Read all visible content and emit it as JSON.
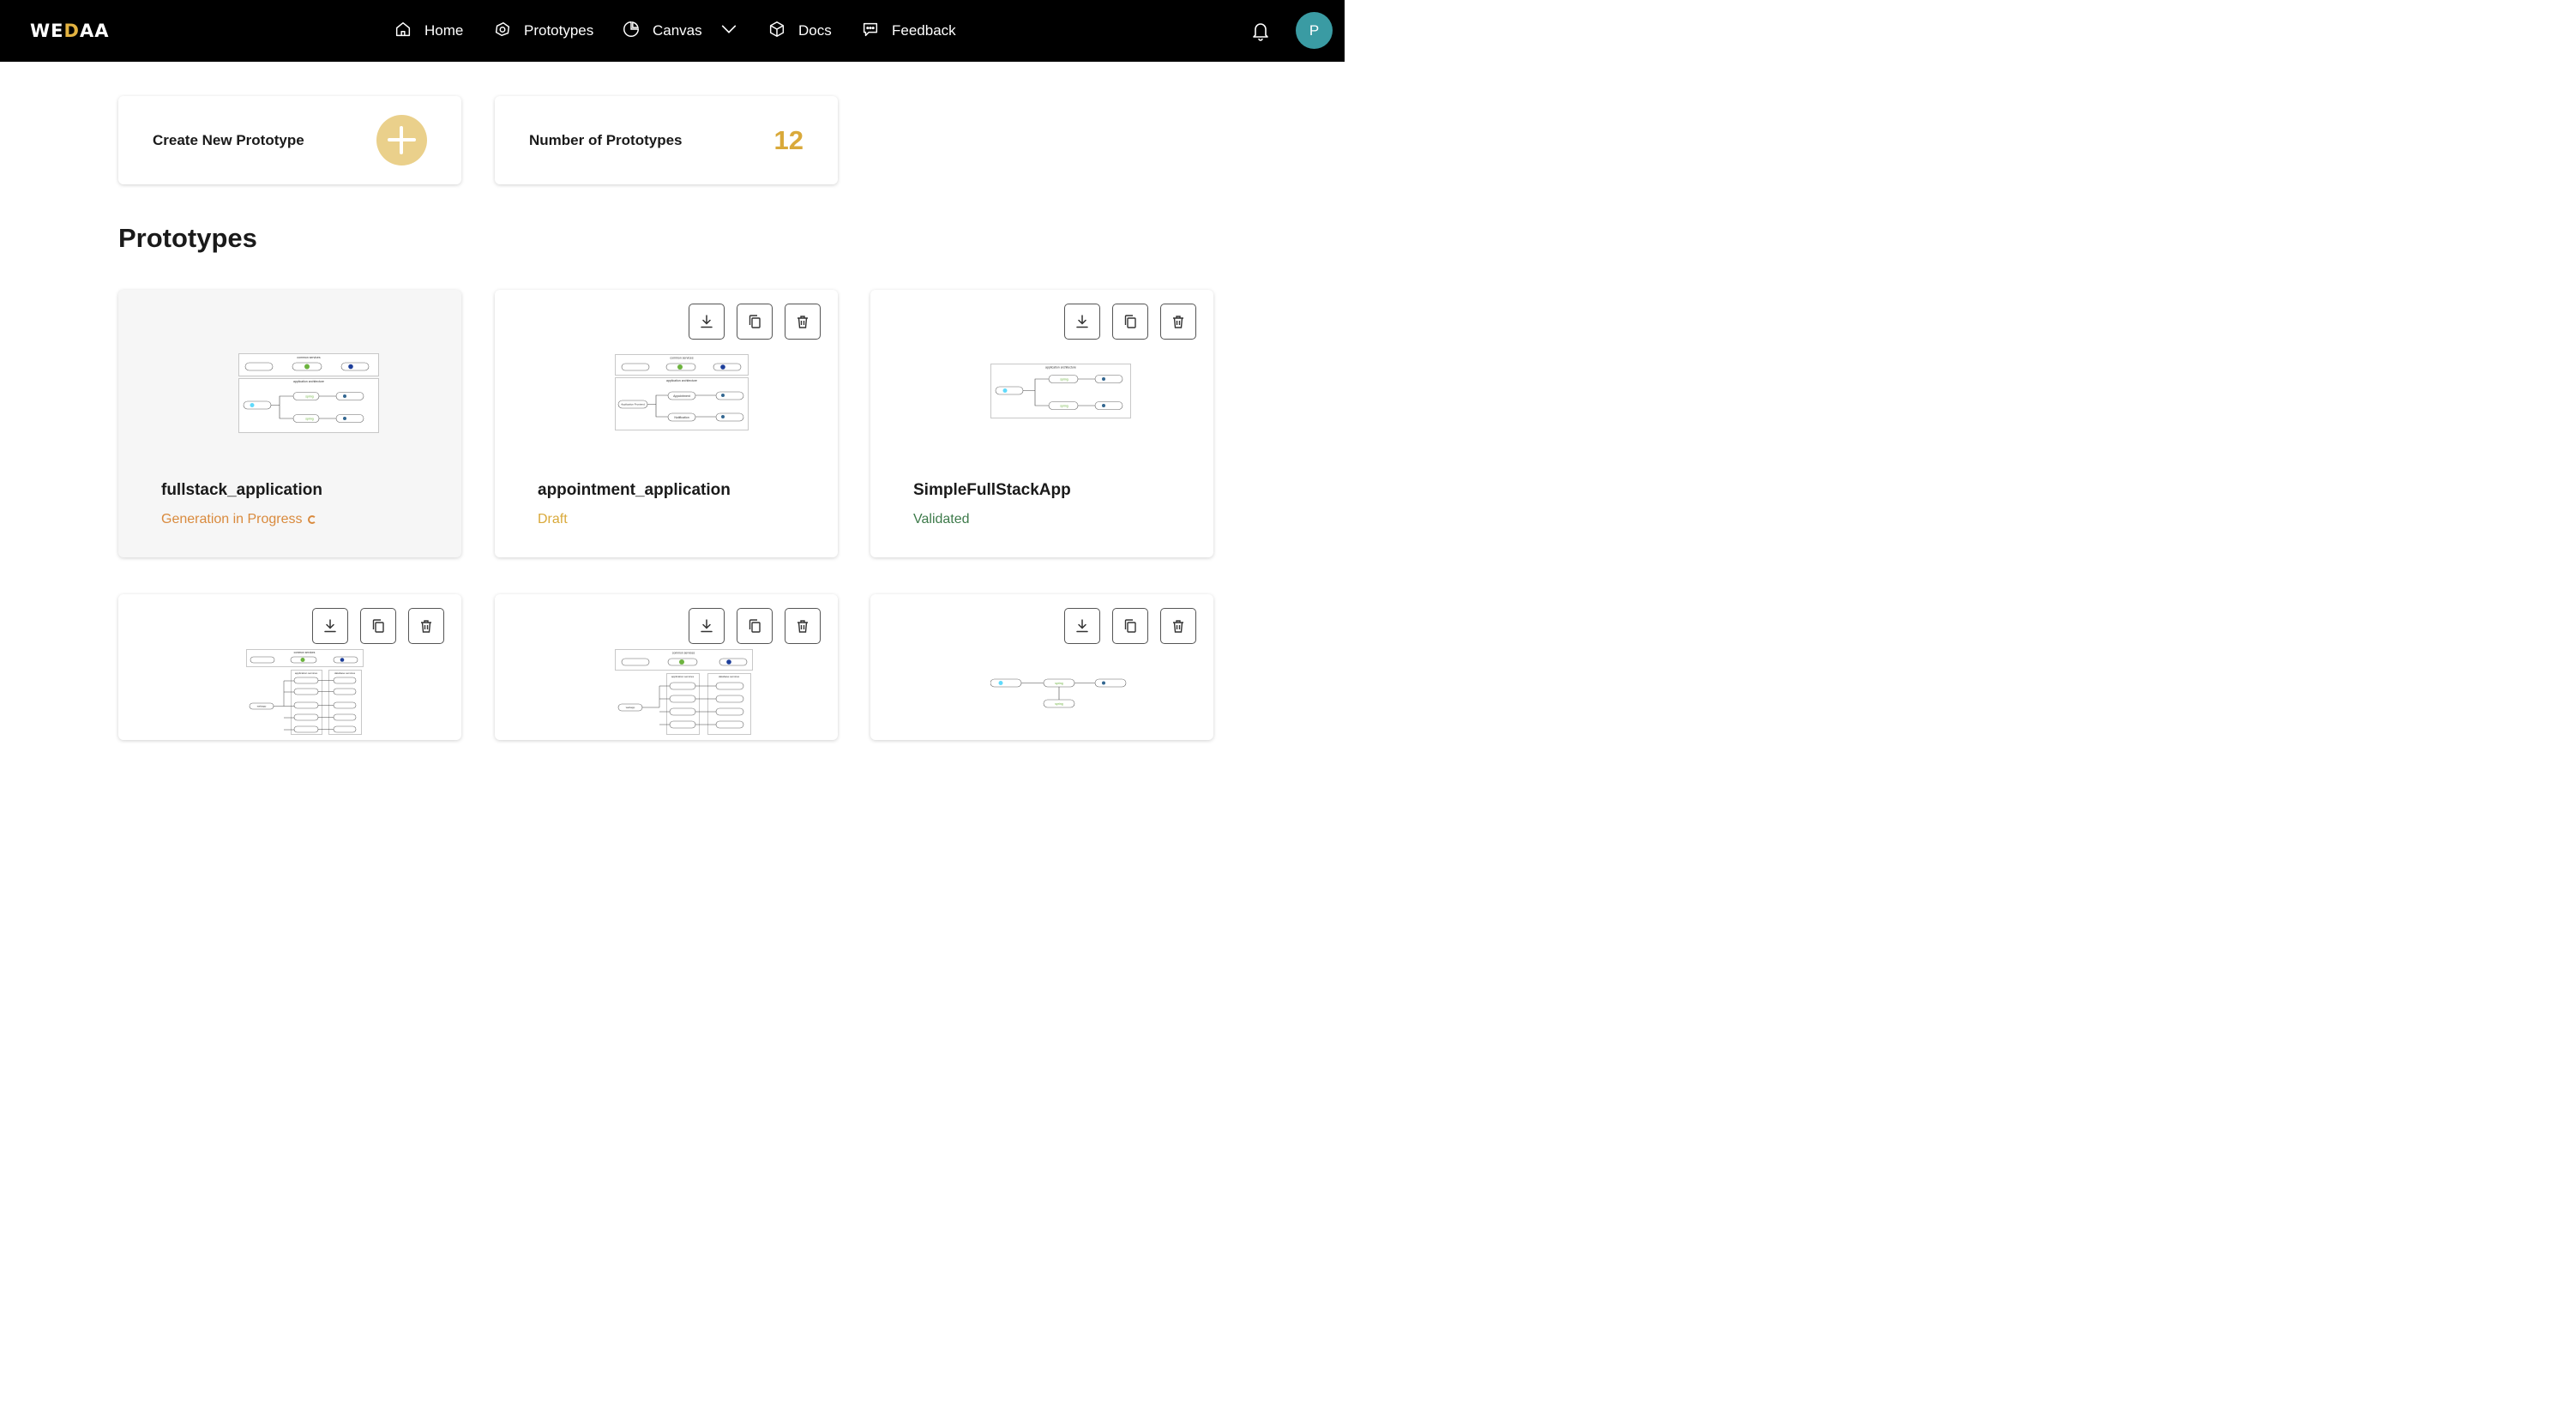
{
  "app": {
    "logo_text_pre": "WE",
    "logo_text_accent": "D",
    "logo_text_post": "AA",
    "brand_accent": "#e3b341"
  },
  "nav": {
    "items": [
      {
        "label": "Home",
        "icon": "home-icon"
      },
      {
        "label": "Prototypes",
        "icon": "prototypes-icon"
      },
      {
        "label": "Canvas",
        "icon": "canvas-icon"
      },
      {
        "label": "Docs",
        "icon": "cube-icon"
      },
      {
        "label": "Feedback",
        "icon": "chat-icon"
      }
    ],
    "avatar_initial": "P"
  },
  "summary": {
    "create_label": "Create New Prototype",
    "count_label": "Number of Prototypes",
    "count_value": "12"
  },
  "section": {
    "title": "Prototypes"
  },
  "prototypes": [
    {
      "name": "fullstack_application",
      "status": "Generation in Progress",
      "status_color": "#d98a3d"
    },
    {
      "name": "appointment_application",
      "status": "Draft",
      "status_color": "#d9a93a"
    },
    {
      "name": "SimpleFullStackApp",
      "status": "Validated",
      "status_color": "#3d7a4a"
    }
  ],
  "thumb_text": {
    "common_services": "common services",
    "app_architecture": "application architecture",
    "app_services": "application services",
    "db_services": "database services",
    "spring": "spring",
    "appointment": "Appointment",
    "notification": "Notification",
    "app_frontend": "Application Frontend",
    "webapp": "webapp"
  },
  "colors": {
    "status_progress": "#d98a3d",
    "status_draft": "#d9a93a",
    "status_validated": "#3d7a4a",
    "avatar_bg": "#3a9ba3"
  }
}
